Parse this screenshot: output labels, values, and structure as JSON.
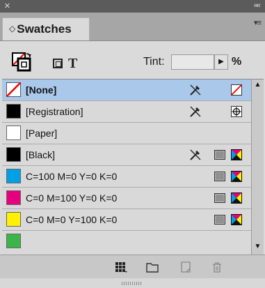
{
  "panel": {
    "title": "Swatches",
    "close_glyph": "×",
    "collapse_glyph": "««",
    "menu_glyph": "▾≡"
  },
  "toolbar": {
    "tint_label": "Tint:",
    "tint_value": "",
    "percent": "%",
    "format_text_label": "T"
  },
  "swatches": [
    {
      "name": "[None]",
      "color": "none",
      "selected": true,
      "icons": [
        "no-edit-icon",
        "none-icon"
      ]
    },
    {
      "name": "[Registration]",
      "color": "#000000",
      "selected": false,
      "icons": [
        "no-edit-icon",
        "registration-icon"
      ]
    },
    {
      "name": "[Paper]",
      "color": "#ffffff",
      "selected": false,
      "icons": []
    },
    {
      "name": "[Black]",
      "color": "#000000",
      "selected": false,
      "icons": [
        "no-edit-icon",
        "process-icon",
        "cmyk-icon"
      ]
    },
    {
      "name": "C=100 M=0 Y=0 K=0",
      "color": "#00a0e6",
      "selected": false,
      "icons": [
        "process-icon",
        "cmyk-icon"
      ]
    },
    {
      "name": "C=0 M=100 Y=0 K=0",
      "color": "#e6007e",
      "selected": false,
      "icons": [
        "process-icon",
        "cmyk-icon"
      ]
    },
    {
      "name": "C=0 M=0 Y=100 K=0",
      "color": "#fff100",
      "selected": false,
      "icons": [
        "process-icon",
        "cmyk-icon"
      ]
    }
  ],
  "colors": {
    "selection": "#aac8e9",
    "panel_bg": "#dadada",
    "titlebar": "#5b5b5b"
  }
}
